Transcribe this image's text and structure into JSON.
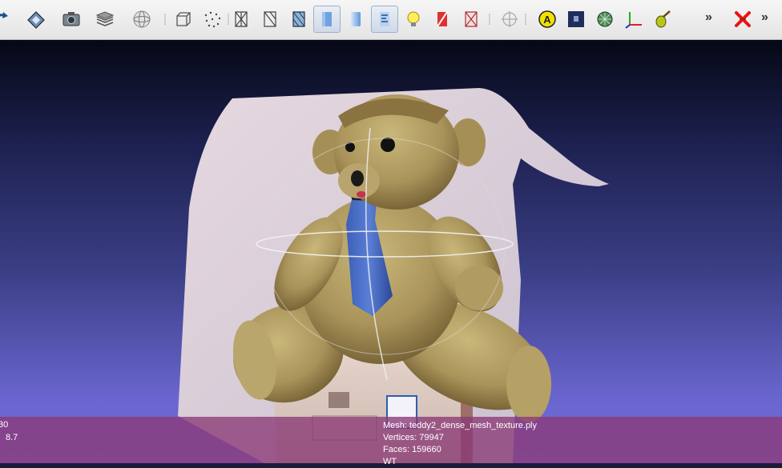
{
  "toolbar": {
    "overflow_label": "»",
    "items": [
      {
        "icon": "import-icon",
        "active": false
      },
      {
        "icon": "save-icon",
        "active": false
      },
      {
        "icon": "snapshot-icon",
        "active": false
      },
      {
        "icon": "layers-icon",
        "active": false
      },
      {
        "icon": "trackball-icon",
        "active": false
      },
      {
        "icon": "bounding-box-icon",
        "active": false
      },
      {
        "icon": "points-icon",
        "active": false
      },
      {
        "icon": "wireframe-icon",
        "active": false
      },
      {
        "icon": "hidden-lines-icon",
        "active": false
      },
      {
        "icon": "flat-lines-icon",
        "active": false
      },
      {
        "icon": "flat-shading-icon",
        "active": true
      },
      {
        "icon": "smooth-shading-icon",
        "active": false
      },
      {
        "icon": "texture-icon",
        "active": true
      },
      {
        "icon": "light-icon",
        "active": false
      },
      {
        "icon": "color-mode-icon",
        "active": false
      },
      {
        "icon": "selection-icon",
        "active": false
      },
      {
        "icon": "crosshair-icon",
        "active": false
      },
      {
        "icon": "annotation-icon",
        "active": false
      },
      {
        "icon": "raster-icon",
        "active": false
      },
      {
        "icon": "mesh-filter-icon",
        "active": false
      },
      {
        "icon": "axes-icon",
        "active": false
      },
      {
        "icon": "paint-icon",
        "active": false
      },
      {
        "icon": "delete-icon",
        "active": false
      }
    ]
  },
  "info": {
    "left_top": "30",
    "left_bottom": "8.7",
    "mesh": "Mesh: teddy2_dense_mesh_texture.ply",
    "vertices": "Vertices: 79947",
    "faces": "Faces: 159660",
    "extra": "WT"
  },
  "colors": {
    "background_top": "#060816",
    "background_bottom": "#7268d8",
    "infobar": "#8a3a76",
    "toolbar": "#ececec"
  }
}
